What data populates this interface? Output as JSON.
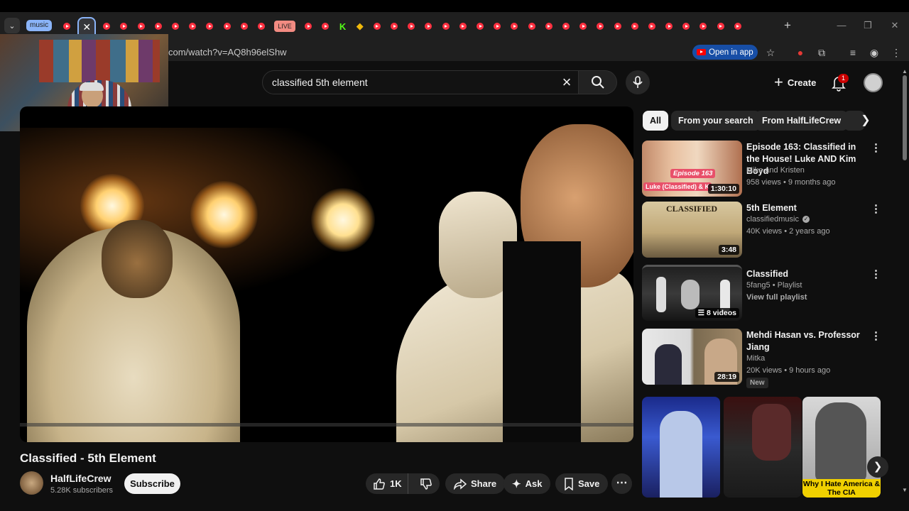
{
  "browser": {
    "tab_group_label": "music",
    "active_tab_close": "✕",
    "live_tab_label": "LIVE",
    "kick_tab_label": "K",
    "binance_tab_label": "◆",
    "new_tab": "+",
    "window_controls": {
      "minimize": "—",
      "restore": "❐",
      "close": "✕"
    },
    "url": "com/watch?v=AQ8h96elShw",
    "open_in_app": "Open in app"
  },
  "header": {
    "search_value": "classified 5th element",
    "create_label": "Create",
    "notification_count": "1"
  },
  "video": {
    "title": "Classified - 5th Element",
    "channel_name": "HalfLifeCrew",
    "subscribers": "5.28K subscribers",
    "subscribe_label": "Subscribe",
    "like_count": "1K",
    "share_label": "Share",
    "ask_label": "Ask",
    "save_label": "Save"
  },
  "chips": [
    {
      "label": "All",
      "selected": true
    },
    {
      "label": "From your search",
      "selected": false
    },
    {
      "label": "From HalfLifeCrew",
      "selected": false
    }
  ],
  "recommendations": [
    {
      "title": "Episode 163: Classified in the House! Luke AND Kim Boyd",
      "channel": "Mike and Kristen",
      "meta": "958 views • 9 months ago",
      "duration": "1:30:10",
      "thumb_text": "Episode 163",
      "thumb_text2": "Luke (Classified) & K"
    },
    {
      "title": "5th Element",
      "channel": "classifiedmusic",
      "verified": true,
      "meta": "40K views • 2 years ago",
      "duration": "3:48",
      "thumb_text": "CLASSIFIED"
    },
    {
      "title": "Classified",
      "channel": "5fang5 • Playlist",
      "meta": "View full playlist",
      "duration": "8 videos"
    },
    {
      "title": "Mehdi Hasan vs. Professor Jiang",
      "channel": "Mitka",
      "meta": "20K views • 9 hours ago",
      "duration": "28:19",
      "badge": "New"
    }
  ],
  "shorts": [
    {
      "caption": ""
    },
    {
      "caption": ""
    },
    {
      "caption": "Why I Hate America & The CIA"
    }
  ],
  "colors": {
    "accent_red": "#ff0000",
    "chip_selected": "#f1f1f1",
    "open_app_blue": "#174ea6"
  }
}
